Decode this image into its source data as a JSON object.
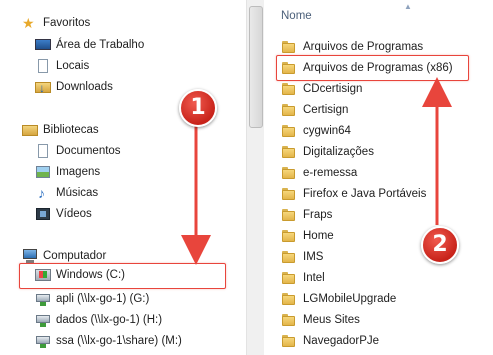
{
  "nav": {
    "favorites": {
      "label": "Favoritos",
      "items": [
        {
          "label": "Área de Trabalho",
          "icon": "desktop-icon"
        },
        {
          "label": "Locais",
          "icon": "recent-places-icon"
        },
        {
          "label": "Downloads",
          "icon": "downloads-folder-icon"
        }
      ]
    },
    "libraries": {
      "label": "Bibliotecas",
      "items": [
        {
          "label": "Documentos",
          "icon": "documents-icon"
        },
        {
          "label": "Imagens",
          "icon": "pictures-icon"
        },
        {
          "label": "Músicas",
          "icon": "music-icon"
        },
        {
          "label": "Vídeos",
          "icon": "videos-icon"
        }
      ]
    },
    "computer": {
      "label": "Computador",
      "items": [
        {
          "label": "Windows (C:)",
          "icon": "windows-drive-icon"
        },
        {
          "label": "apli (\\\\lx-go-1) (G:)",
          "icon": "network-drive-icon"
        },
        {
          "label": "dados (\\\\lx-go-1) (H:)",
          "icon": "network-drive-icon"
        },
        {
          "label": "ssa (\\\\lx-go-1\\share) (M:)",
          "icon": "network-drive-icon"
        }
      ]
    }
  },
  "content": {
    "column_header": "Nome",
    "files": [
      "Arquivos de Programas",
      "Arquivos de Programas (x86)",
      "CDcertisign",
      "Certisign",
      "cygwin64",
      "Digitalizações",
      "e-remessa",
      "Firefox e Java Portáveis",
      "Fraps",
      "Home",
      "IMS",
      "Intel",
      "LGMobileUpgrade",
      "Meus Sites",
      "NavegadorPJe"
    ]
  },
  "annotations": {
    "badge1": "1",
    "badge2": "2",
    "color": "#e8453c"
  }
}
